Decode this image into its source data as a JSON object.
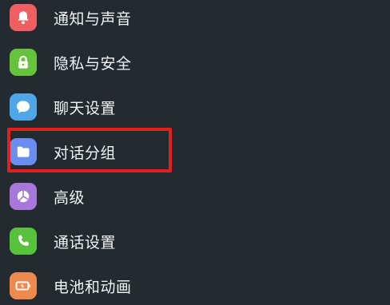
{
  "colors": {
    "background": "#232a30",
    "text": "#f2f4f5",
    "highlight": "#e3201f"
  },
  "settings": {
    "items": [
      {
        "label": "通知与声音",
        "icon": "bell-icon",
        "color": "#ef5f62"
      },
      {
        "label": "隐私与安全",
        "icon": "lock-icon",
        "color": "#65c33c"
      },
      {
        "label": "聊天设置",
        "icon": "chat-bubble-icon",
        "color": "#4fa7e8"
      },
      {
        "label": "对话分组",
        "icon": "folder-icon",
        "color": "#6b8cf0",
        "highlighted": true
      },
      {
        "label": "高级",
        "icon": "pie-chart-icon",
        "color": "#a777d9"
      },
      {
        "label": "通话设置",
        "icon": "phone-icon",
        "color": "#57c23c"
      },
      {
        "label": "电池和动画",
        "icon": "battery-icon",
        "color": "#ef8a4f"
      }
    ]
  }
}
